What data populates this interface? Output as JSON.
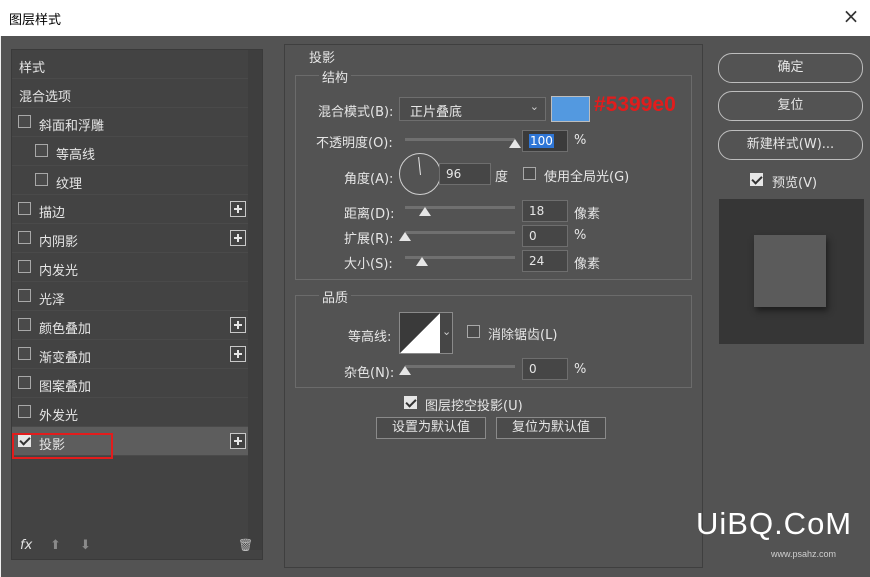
{
  "window": {
    "title": "图层样式",
    "close_glyph": "×"
  },
  "left_panel": {
    "header": "样式",
    "blend_options": "混合选项",
    "items": [
      {
        "label": "斜面和浮雕",
        "checked": false,
        "indent": false,
        "plus": false
      },
      {
        "label": "等高线",
        "checked": false,
        "indent": true,
        "plus": false
      },
      {
        "label": "纹理",
        "checked": false,
        "indent": true,
        "plus": false
      },
      {
        "label": "描边",
        "checked": false,
        "indent": false,
        "plus": true
      },
      {
        "label": "内阴影",
        "checked": false,
        "indent": false,
        "plus": true
      },
      {
        "label": "内发光",
        "checked": false,
        "indent": false,
        "plus": false
      },
      {
        "label": "光泽",
        "checked": false,
        "indent": false,
        "plus": false
      },
      {
        "label": "颜色叠加",
        "checked": false,
        "indent": false,
        "plus": true
      },
      {
        "label": "渐变叠加",
        "checked": false,
        "indent": false,
        "plus": true
      },
      {
        "label": "图案叠加",
        "checked": false,
        "indent": false,
        "plus": false
      },
      {
        "label": "外发光",
        "checked": false,
        "indent": false,
        "plus": false
      },
      {
        "label": "投影",
        "checked": true,
        "indent": false,
        "plus": true,
        "selected": true
      }
    ],
    "footer": {
      "fx": "fx",
      "up": "⬆",
      "down": "⬇",
      "trash": "🗑"
    }
  },
  "drop_shadow": {
    "section_title": "投影",
    "structure": {
      "title": "结构",
      "blend_mode_label": "混合模式(B):",
      "blend_mode_value": "正片叠底",
      "color": "#5399e0",
      "color_annotation": "#5399e0",
      "opacity_label": "不透明度(O):",
      "opacity_value": "100",
      "opacity_unit": "%",
      "opacity": 1.0,
      "angle_label": "角度(A):",
      "angle_value": "96",
      "angle_unit": "度",
      "global_light_label": "使用全局光(G)",
      "global_light_checked": false,
      "distance_label": "距离(D):",
      "distance_value": "18",
      "distance_unit": "像素",
      "distance_fraction": 0.18,
      "spread_label": "扩展(R):",
      "spread_value": "0",
      "spread_unit": "%",
      "spread_fraction": 0,
      "size_label": "大小(S):",
      "size_value": "24",
      "size_unit": "像素",
      "size_fraction": 0.15
    },
    "quality": {
      "title": "品质",
      "contour_label": "等高线:",
      "anti_alias_label": "消除锯齿(L)",
      "anti_alias_checked": false,
      "noise_label": "杂色(N):",
      "noise_value": "0",
      "noise_unit": "%",
      "noise_fraction": 0
    },
    "knockout_label": "图层挖空投影(U)",
    "knockout_checked": true,
    "make_default": "设置为默认值",
    "reset_default": "复位为默认值"
  },
  "right_panel": {
    "ok": "确定",
    "reset": "复位",
    "new_style": "新建样式(W)...",
    "preview_label": "预览(V)",
    "preview_checked": true
  },
  "watermark": {
    "main": "UiBQ.CoM",
    "sub": "www.psahz.com"
  }
}
